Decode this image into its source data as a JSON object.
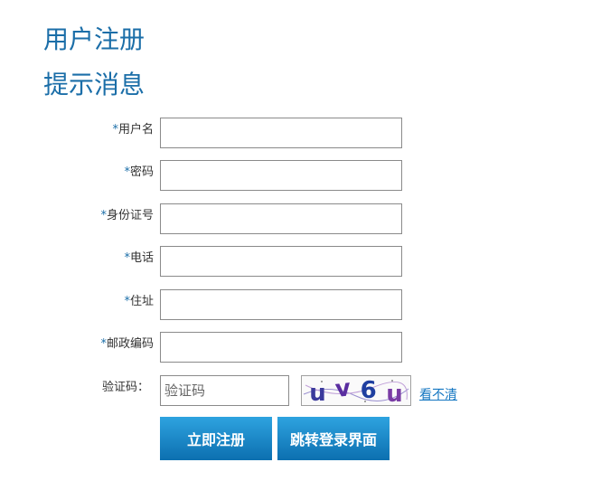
{
  "header": {
    "title": "用户注册",
    "subtitle": "提示消息"
  },
  "form": {
    "required_mark": "*",
    "fields": [
      {
        "label": "用户名",
        "value": ""
      },
      {
        "label": "密码",
        "value": ""
      },
      {
        "label": "身份证号",
        "value": ""
      },
      {
        "label": "电话",
        "value": ""
      },
      {
        "label": "住址",
        "value": ""
      },
      {
        "label": "邮政编码",
        "value": ""
      }
    ],
    "captcha": {
      "label": "验证码：",
      "placeholder": "验证码",
      "image_text": "uv6u",
      "refresh_link": "看不清"
    }
  },
  "buttons": {
    "register": "立即注册",
    "goto_login": "跳转登录界面"
  },
  "colors": {
    "title": "#1b6ea8",
    "button_top": "#2ea3e0",
    "button_bottom": "#0c6fb0",
    "link": "#1577c2"
  }
}
